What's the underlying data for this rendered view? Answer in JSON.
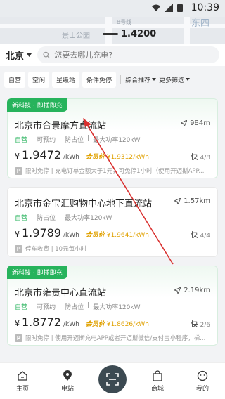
{
  "status_bar": {
    "time": "10:39"
  },
  "map": {
    "labels": [
      "景山公园",
      "东四",
      "8号线"
    ],
    "price_pin": "1.4200"
  },
  "search": {
    "city": "北京",
    "placeholder": "您要去哪儿充电?"
  },
  "filters": [
    "自营",
    "空闲",
    "星级站",
    "条件免停"
  ],
  "sort_options": [
    "综合推荐",
    "更多筛选"
  ],
  "stations": [
    {
      "badge": "新科技 · 即插即充",
      "name": "北京市合景摩方直流站",
      "distance": "984m",
      "self_tag": "自营",
      "meta": [
        "可预约",
        "防占位",
        "最大功率120kW"
      ],
      "currency": "¥",
      "price": "1.9472",
      "unit": "/kWh",
      "vip_label": "会员价",
      "vip_price": "¥1.9312/kWh",
      "fast_label": "快",
      "fast_count": "4/8",
      "note": "限时免停 | 充电订单金额大于1元，可免停1小时（使用开迈斯APP..."
    },
    {
      "badge": "",
      "name": "北京市金宝汇购物中心地下直流站",
      "distance": "1.57km",
      "self_tag": "自营",
      "meta": [
        "防占位",
        "最大功率120kW"
      ],
      "currency": "¥",
      "price": "1.9789",
      "unit": "/kWh",
      "vip_label": "会员价",
      "vip_price": "¥1.9641/kWh",
      "fast_label": "快",
      "fast_count": "4/4",
      "note": "停车收费 | 10元每小时"
    },
    {
      "badge": "新科技 · 即插即充",
      "name": "北京市雍贵中心直流站",
      "distance": "2.19km",
      "self_tag": "自营",
      "meta": [
        "可预约",
        "防占位",
        "最大功率120kW"
      ],
      "currency": "¥",
      "price": "1.8772",
      "unit": "/kWh",
      "vip_label": "会员价",
      "vip_price": "¥1.8626/kWh",
      "fast_label": "快",
      "fast_count": "2/6",
      "note": "限时免停 | 使用开迈斯充电APP或者开迈斯微信/支付宝小程序，梯..."
    }
  ],
  "tabs": [
    "主页",
    "电站",
    "",
    "商城",
    "我的"
  ],
  "colors": {
    "accent": "#27b35c",
    "vip": "#e0a100",
    "arrow": "#d9302f"
  }
}
